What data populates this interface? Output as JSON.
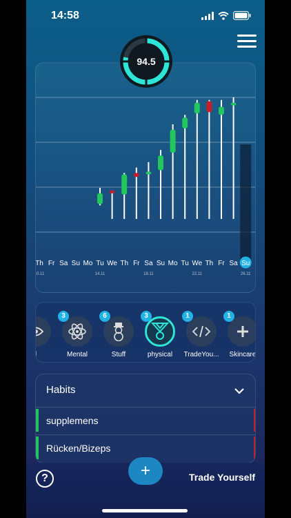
{
  "status_bar": {
    "time": "14:58"
  },
  "score": {
    "value": "94.5",
    "fraction": 0.78
  },
  "chart_data": {
    "type": "bar",
    "days": [
      "Th",
      "Fr",
      "Sa",
      "Su",
      "Mo",
      "Tu",
      "We",
      "Th",
      "Fr",
      "Sa",
      "Su",
      "Mo",
      "Tu",
      "We",
      "Th",
      "Fr",
      "Sa",
      "Su"
    ],
    "date_labels": [
      {
        "index": 0,
        "text": "10.11"
      },
      {
        "index": 5,
        "text": "14.11"
      },
      {
        "index": 9,
        "text": "18.11"
      },
      {
        "index": 13,
        "text": "22.11"
      },
      {
        "index": 17,
        "text": "26.11"
      }
    ],
    "selected_index": 17,
    "candles": [
      {
        "index": 5,
        "low": 10,
        "high": 23,
        "open": 11,
        "close": 19,
        "color": "green"
      },
      {
        "index": 6,
        "low": 0,
        "high": 21,
        "open": 21,
        "close": 19,
        "color": "red"
      },
      {
        "index": 7,
        "low": 0,
        "high": 34,
        "open": 18,
        "close": 33,
        "color": "green"
      },
      {
        "index": 8,
        "low": 0,
        "high": 38,
        "open": 34,
        "close": 31,
        "color": "red"
      },
      {
        "index": 9,
        "low": 0,
        "high": 42,
        "open": 33,
        "close": 35,
        "color": "green"
      },
      {
        "index": 10,
        "low": 0,
        "high": 51,
        "open": 36,
        "close": 47,
        "color": "green"
      },
      {
        "index": 11,
        "low": 0,
        "high": 70,
        "open": 49,
        "close": 66,
        "color": "green"
      },
      {
        "index": 12,
        "low": 0,
        "high": 77,
        "open": 67,
        "close": 75,
        "color": "green"
      },
      {
        "index": 13,
        "low": 0,
        "high": 88,
        "open": 78,
        "close": 86,
        "color": "green"
      },
      {
        "index": 14,
        "low": 0,
        "high": 88,
        "open": 87,
        "close": 79,
        "color": "red"
      },
      {
        "index": 15,
        "low": 0,
        "high": 88,
        "open": 77,
        "close": 83,
        "color": "green"
      },
      {
        "index": 16,
        "low": 0,
        "high": 90,
        "open": 84,
        "close": 86,
        "color": "green"
      }
    ],
    "ylim": [
      0,
      95
    ],
    "grid": true
  },
  "categories": [
    {
      "label": "l",
      "badge": "",
      "icon": "eye-icon",
      "active": false
    },
    {
      "label": "Mental",
      "badge": "3",
      "icon": "atom-icon",
      "active": false
    },
    {
      "label": "Stuff",
      "badge": "6",
      "icon": "snowman-icon",
      "active": false
    },
    {
      "label": "physical",
      "badge": "3",
      "icon": "medal-icon",
      "active": true
    },
    {
      "label": "TradeYou...",
      "badge": "1",
      "icon": "code-icon",
      "active": false
    },
    {
      "label": "Skincare",
      "badge": "1",
      "icon": "plus-icon",
      "active": false
    }
  ],
  "habits": {
    "title": "Habits",
    "items": [
      {
        "name": "supplemens"
      },
      {
        "name": "Rücken/Bizeps"
      }
    ]
  },
  "bottom_bar": {
    "help": "?",
    "add": "+",
    "brand": "Trade Yourself"
  },
  "colors": {
    "green": "#22c55e",
    "red": "#c41e2a",
    "accent": "#2ee6d8",
    "badge": "#23b2e6"
  }
}
